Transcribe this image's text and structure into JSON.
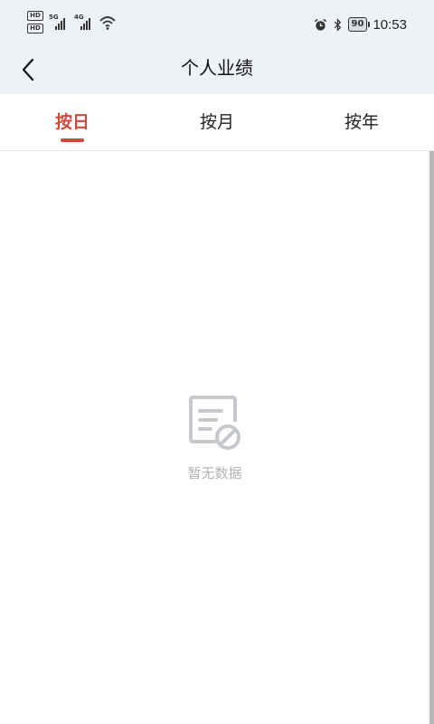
{
  "status_bar": {
    "sim1_badge": "HD",
    "sim2_badge": "HD",
    "sim1_network": "5G",
    "sim2_network": "4G",
    "battery": "90",
    "time": "10:53",
    "icons": [
      "hd-icon",
      "signal-icon",
      "wifi-icon",
      "alarm-icon",
      "bluetooth-icon",
      "battery-icon"
    ]
  },
  "header": {
    "back_icon": "chevron-left-icon",
    "title": "个人业绩"
  },
  "tabs": {
    "items": [
      {
        "label": "按日",
        "active": true
      },
      {
        "label": "按月",
        "active": false
      },
      {
        "label": "按年",
        "active": false
      }
    ]
  },
  "empty_state": {
    "icon": "no-data-document-icon",
    "text": "暂无数据"
  },
  "colors": {
    "accent": "#cc4b3d",
    "header_bg": "#eef1f6",
    "empty_text": "#b3b3b3"
  }
}
